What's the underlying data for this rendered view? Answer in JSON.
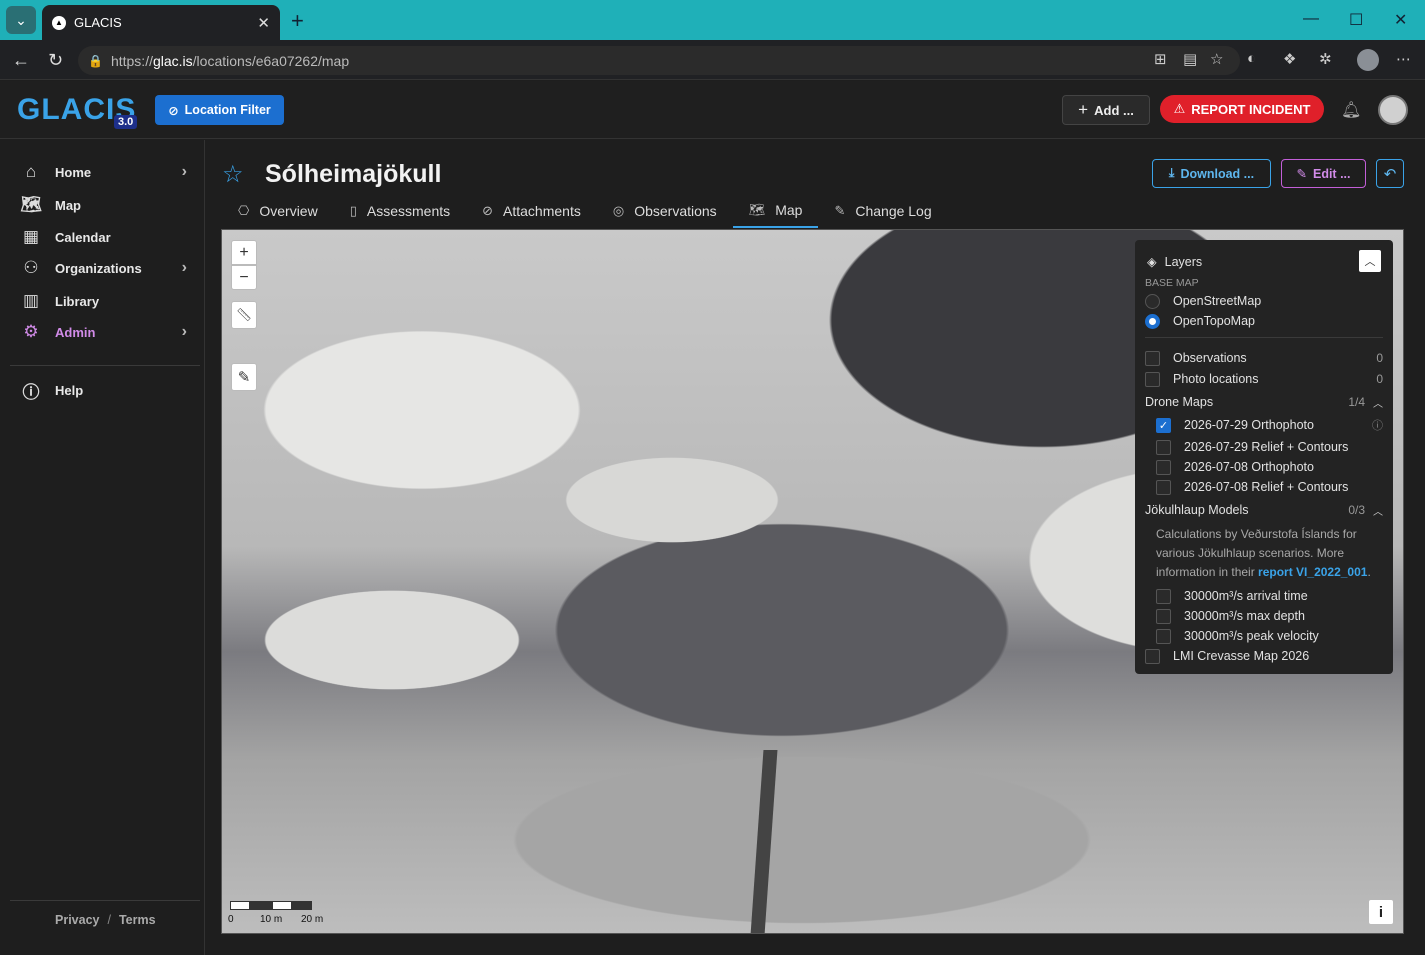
{
  "browser": {
    "tab_title": "GLACIS",
    "url_scheme": "https://",
    "url_host": "glac.is",
    "url_path": "/locations/e6a07262/map"
  },
  "header": {
    "logo": "GLACIS",
    "version": "3.0",
    "location_filter": "Location Filter",
    "add_label": "Add ...",
    "report_label": "REPORT INCIDENT"
  },
  "sidebar": {
    "items": [
      {
        "label": "Home",
        "icon": "home-icon",
        "chevron": true
      },
      {
        "label": "Map",
        "icon": "map-icon",
        "chevron": false
      },
      {
        "label": "Calendar",
        "icon": "calendar-icon",
        "chevron": false
      },
      {
        "label": "Organizations",
        "icon": "organizations-icon",
        "chevron": true
      },
      {
        "label": "Library",
        "icon": "library-icon",
        "chevron": false
      },
      {
        "label": "Admin",
        "icon": "gear-icon",
        "chevron": true,
        "color": "#d18be8"
      }
    ],
    "help": "Help",
    "footer": {
      "privacy": "Privacy",
      "separator": "/",
      "terms": "Terms"
    }
  },
  "page": {
    "title": "Sólheimajökull",
    "download": "Download ...",
    "edit": "Edit ...",
    "tabs": [
      {
        "label": "Overview",
        "icon": "overview-icon"
      },
      {
        "label": "Assessments",
        "icon": "assessments-icon"
      },
      {
        "label": "Attachments",
        "icon": "paperclip-icon"
      },
      {
        "label": "Observations",
        "icon": "pin-icon"
      },
      {
        "label": "Map",
        "icon": "map-icon",
        "active": true
      },
      {
        "label": "Change Log",
        "icon": "changelog-icon"
      }
    ]
  },
  "map": {
    "zoom_in": "+",
    "zoom_out": "−",
    "scale": {
      "labels": [
        "0",
        "10 m",
        "20 m"
      ]
    },
    "info": "i"
  },
  "layers": {
    "title": "Layers",
    "base_map_label": "BASE MAP",
    "base_maps": [
      {
        "label": "OpenStreetMap",
        "selected": false
      },
      {
        "label": "OpenTopoMap",
        "selected": true
      }
    ],
    "observations": {
      "label": "Observations",
      "count": "0",
      "checked": false
    },
    "photo_locations": {
      "label": "Photo locations",
      "count": "0",
      "checked": false
    },
    "drone_maps": {
      "label": "Drone Maps",
      "count": "1/4",
      "items": [
        {
          "label": "2026-07-29 Orthophoto",
          "checked": true
        },
        {
          "label": "2026-07-29 Relief + Contours",
          "checked": false
        },
        {
          "label": "2026-07-08 Orthophoto",
          "checked": false
        },
        {
          "label": "2026-07-08 Relief + Contours",
          "checked": false
        }
      ]
    },
    "jokulhlaup": {
      "label": "Jökulhlaup Models",
      "count": "0/3",
      "desc_prefix": "Calculations by Veðurstofa Íslands for various Jökulhlaup scenarios. More information in their ",
      "desc_link": "report VI_2022_001",
      "desc_suffix": ".",
      "items": [
        {
          "label": "30000m³/s arrival time",
          "checked": false
        },
        {
          "label": "30000m³/s max depth",
          "checked": false
        },
        {
          "label": "30000m³/s peak velocity",
          "checked": false
        }
      ]
    },
    "crevasse": {
      "label": "LMI Crevasse Map 2026",
      "checked": false
    }
  },
  "colors": {
    "accent": "#3aa3e8",
    "admin": "#d18be8",
    "report": "#e0202a",
    "browser_frame": "#1fb0b8"
  }
}
